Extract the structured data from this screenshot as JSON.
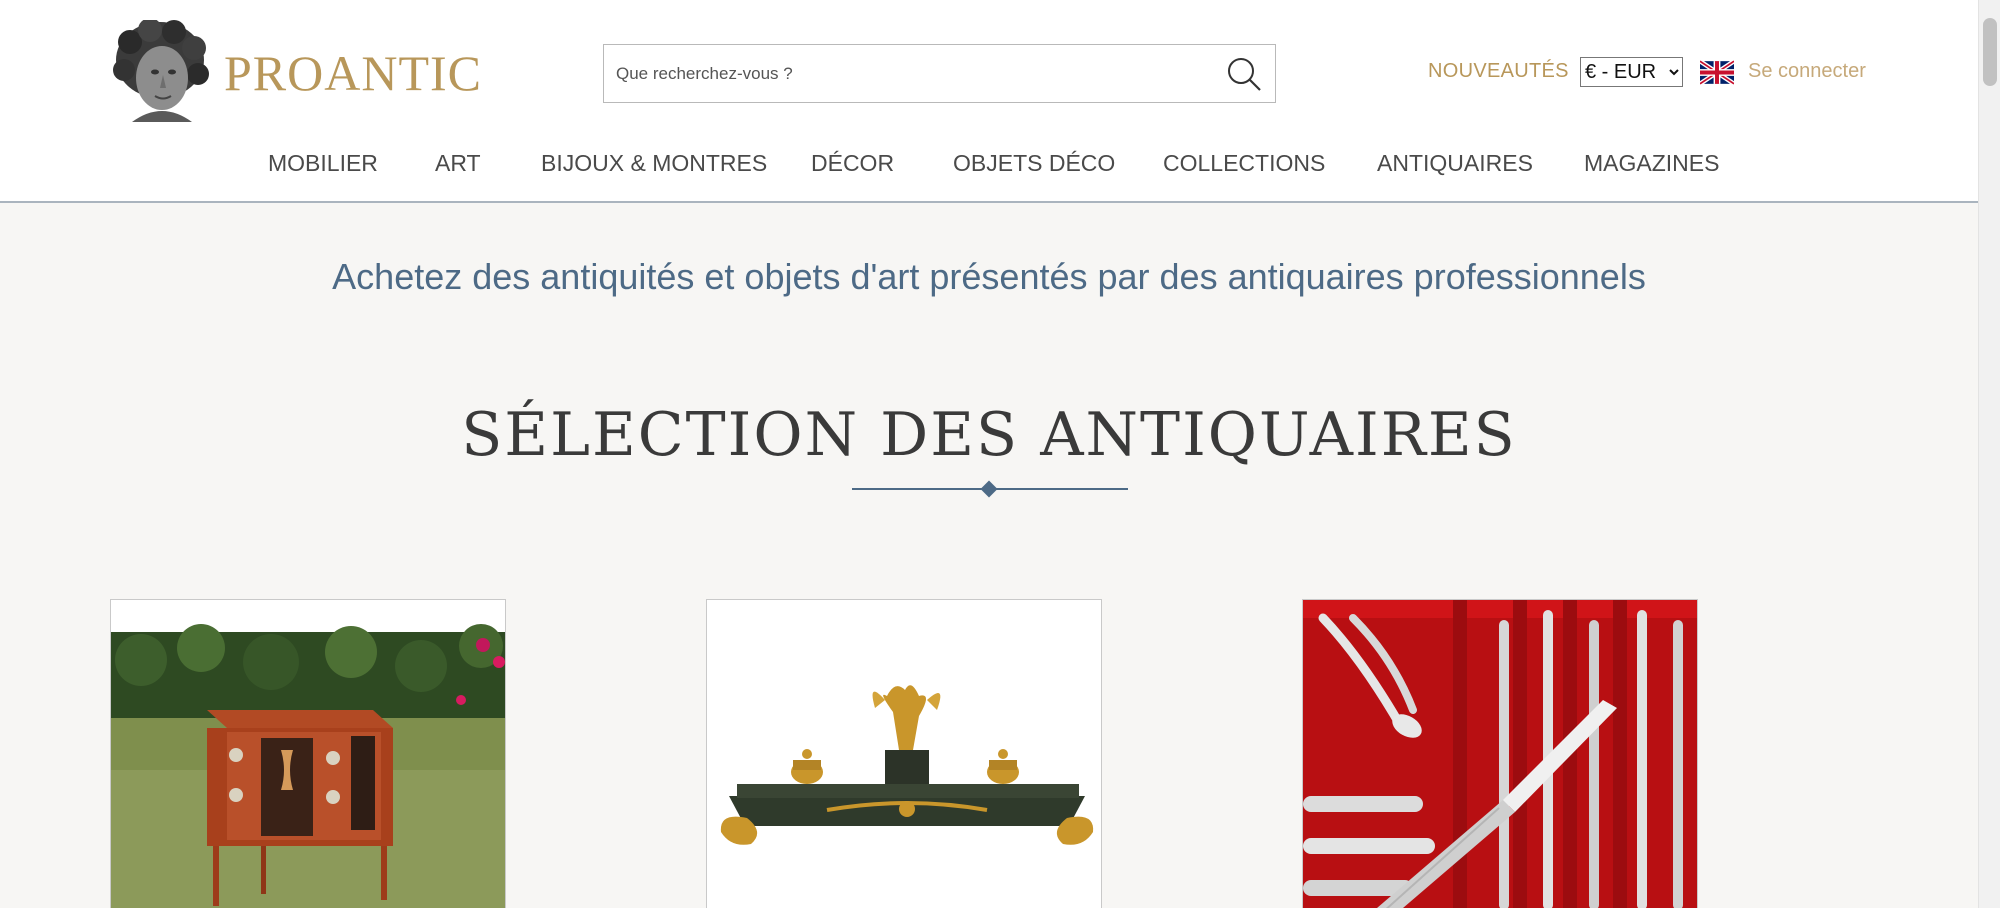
{
  "header": {
    "brand": "PROANTIC",
    "search": {
      "placeholder": "Que recherchez-vous ?"
    },
    "news_label": "NOUVEAUTÉS",
    "currency": "€ - EUR",
    "language_flag_icon": "uk-flag-icon",
    "login_label": "Se connecter"
  },
  "nav": {
    "items": [
      {
        "label": "MOBILIER"
      },
      {
        "label": "ART"
      },
      {
        "label": "BIJOUX & MONTRES"
      },
      {
        "label": "DÉCOR"
      },
      {
        "label": "OBJETS DÉCO"
      },
      {
        "label": "COLLECTIONS"
      },
      {
        "label": "ANTIQUAIRES"
      },
      {
        "label": "MAGAZINES"
      }
    ]
  },
  "main": {
    "tagline": "Achetez des antiquités et objets d'art présentés par des antiquaires professionnels",
    "section_title": "SÉLECTION DES ANTIQUAIRES",
    "cards": [
      {
        "image": "inlaid-commode-photo"
      },
      {
        "image": "empire-eagle-inkstand-photo"
      },
      {
        "image": "silver-cutlery-set-photo"
      }
    ]
  },
  "colors": {
    "gold": "#b8975a",
    "navy": "#4d6a86",
    "background": "#f7f6f4"
  }
}
